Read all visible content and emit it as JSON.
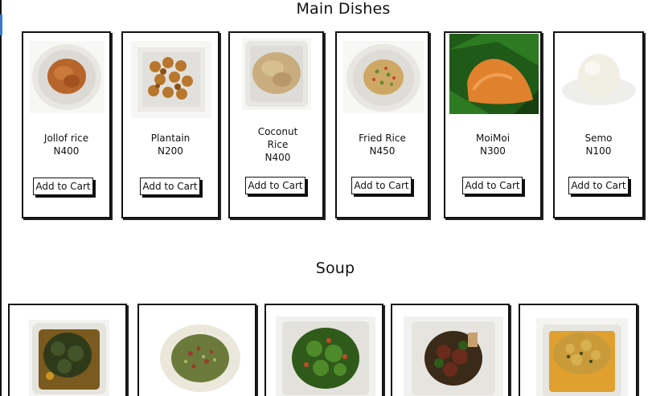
{
  "sections": {
    "main_dishes": {
      "title": "Main Dishes",
      "items": [
        {
          "name": "Jollof rice",
          "price": "N400",
          "button": "Add to Cart",
          "image_icon": "jollof-rice-image"
        },
        {
          "name": "Plantain",
          "price": "N200",
          "button": "Add to Cart",
          "image_icon": "plantain-image"
        },
        {
          "name": "Coconut Rice",
          "price": "N400",
          "button": "Add to Cart",
          "image_icon": "coconut-rice-image"
        },
        {
          "name": "Fried Rice",
          "price": "N450",
          "button": "Add to Cart",
          "image_icon": "fried-rice-image"
        },
        {
          "name": "MoiMoi",
          "price": "N300",
          "button": "Add to Cart",
          "image_icon": "moimoi-image"
        },
        {
          "name": "Semo",
          "price": "N100",
          "button": "Add to Cart",
          "image_icon": "semo-image"
        }
      ]
    },
    "soup": {
      "title": "Soup",
      "items": [
        {
          "image_icon": "vegetable-soup-image"
        },
        {
          "image_icon": "okro-soup-image"
        },
        {
          "image_icon": "efo-riro-image"
        },
        {
          "image_icon": "afang-soup-image"
        },
        {
          "image_icon": "egusi-soup-image"
        }
      ]
    }
  },
  "colors": {
    "card_border": "#111111",
    "accent_tick": "#3a78c9"
  }
}
